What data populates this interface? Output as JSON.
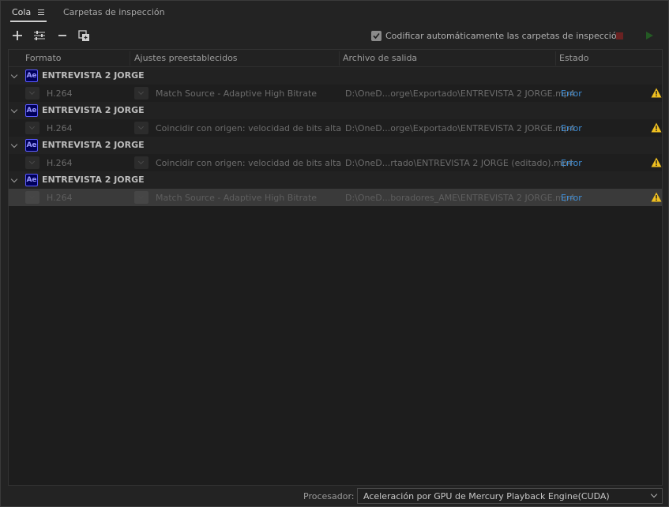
{
  "tabs": [
    {
      "label": "Cola",
      "active": true
    },
    {
      "label": "Carpetas de inspección",
      "active": false
    }
  ],
  "toolbar": {
    "add_icon": "plus-icon",
    "settings_icon": "sliders-icon",
    "remove_icon": "minus-icon",
    "duplicate_icon": "duplicate-icon",
    "auto_encode_checked": true,
    "auto_encode_label": "Codificar automáticamente las carpetas de inspección",
    "stop_color": "#6a2222",
    "start_color": "#245a24"
  },
  "columns": {
    "format": "Formato",
    "presets": "Ajustes preestablecidos",
    "output": "Archivo de salida",
    "status": "Estado"
  },
  "groups": [
    {
      "title": "ENTREVISTA 2 JORGE",
      "app_badge": "Ae",
      "item": {
        "format": "H.264",
        "preset": "Match Source - Adaptive High Bitrate",
        "output": "D:\\OneD...orge\\Exportado\\ENTREVISTA 2 JORGE.mp4",
        "status": "Error",
        "selected": false
      }
    },
    {
      "title": "ENTREVISTA 2 JORGE",
      "app_badge": "Ae",
      "item": {
        "format": "H.264",
        "preset": "Coincidir con origen: velocidad de bits alta",
        "output": "D:\\OneD...orge\\Exportado\\ENTREVISTA 2 JORGE.mp4",
        "status": "Error",
        "selected": false
      }
    },
    {
      "title": "ENTREVISTA 2 JORGE",
      "app_badge": "Ae",
      "item": {
        "format": "H.264",
        "preset": "Coincidir con origen: velocidad de bits alta",
        "output": "D:\\OneD...rtado\\ENTREVISTA 2 JORGE (editado).mp4",
        "status": "Error",
        "selected": false
      }
    },
    {
      "title": "ENTREVISTA 2 JORGE",
      "app_badge": "Ae",
      "item": {
        "format": "H.264",
        "preset": "Match Source - Adaptive High Bitrate",
        "output": "D:\\OneD...boradores_AME\\ENTREVISTA 2 JORGE.mp4",
        "status": "Error",
        "selected": true
      }
    }
  ],
  "footer": {
    "processor_label": "Procesador:",
    "processor_value": "Aceleración por GPU de Mercury Playback Engine(CUDA)"
  },
  "colors": {
    "status_link": "#3f8fd8",
    "warning": "#f0c020",
    "ae_badge_bg": "#00005b",
    "ae_badge_text": "#9999ff"
  }
}
